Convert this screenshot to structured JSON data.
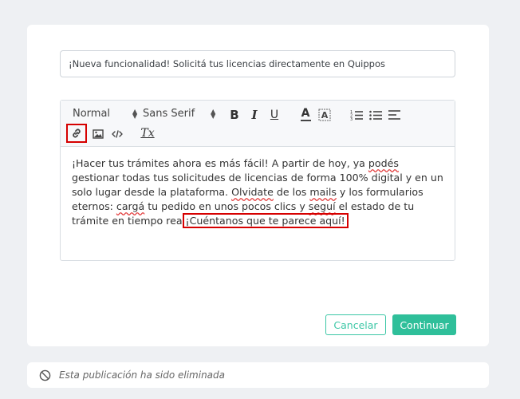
{
  "post": {
    "title_value": "¡Nueva funcionalidad! Solicitá tus licencias directamente en Quippos",
    "toolbar": {
      "header_picker": "Normal",
      "font_picker": "Sans Serif",
      "bold": "B",
      "italic": "I",
      "underline": "U",
      "color": "A",
      "clean": "Tx"
    },
    "body": {
      "seg1": "¡Hacer tus trámites ahora es más fácil! A partir de hoy, ya ",
      "w_podes": "podés",
      "seg2": " gestionar todas tus solicitudes de licencias de forma 100% digital y en un solo lugar desde la plataforma. ",
      "w_olvidate": "Olvidate",
      "seg3": " de los ",
      "w_mails": "mails",
      "seg4": " y los formularios eternos: ",
      "w_carga": "cargá",
      "seg5": " tu pedido en unos pocos clics y ",
      "w_segui": "seguí",
      "seg6": " el estado de tu trámite en tiempo rea",
      "inserted": "¡Cuéntanos que te parece aquí!"
    },
    "cancel_label": "Cancelar",
    "continue_label": "Continuar"
  },
  "deleted_notice": "Esta publicación ha sido eliminada",
  "colors": {
    "accent": "#2fbf9a",
    "highlight": "#d60000",
    "background": "#eef0f3"
  }
}
